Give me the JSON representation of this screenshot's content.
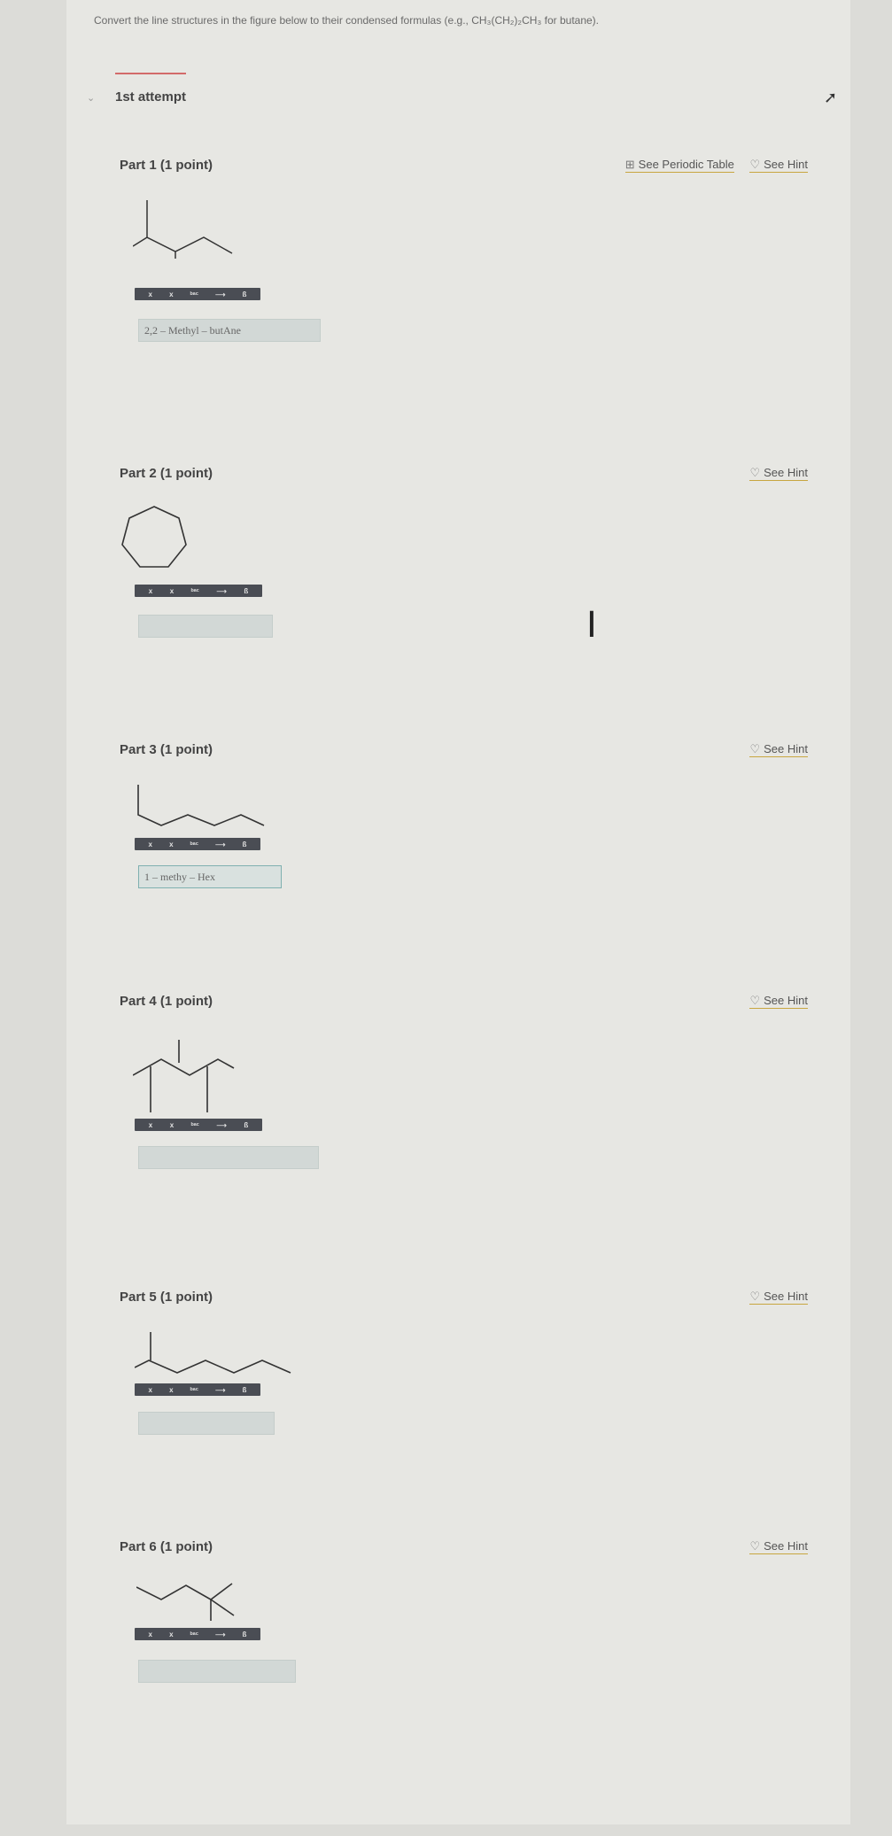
{
  "instructions": "Convert the line structures in the figure below to their condensed formulas (e.g., CH₃(CH₂)₂CH₃ for butane).",
  "attempt": {
    "label": "1st attempt"
  },
  "periodic_table_link": "See Periodic Table",
  "hint_link": "See Hint",
  "toolbar_buttons": [
    "x",
    "x",
    "ᵇᵃᶜ",
    "⟶",
    "ß"
  ],
  "parts": [
    {
      "title": "Part 1  (1 point)",
      "answer": "2,2 – Methyl – butAne"
    },
    {
      "title": "Part 2  (1 point)",
      "answer": ""
    },
    {
      "title": "Part 3  (1 point)",
      "answer": "1 – methy – Hex"
    },
    {
      "title": "Part 4  (1 point)",
      "answer": ""
    },
    {
      "title": "Part 5  (1 point)",
      "answer": ""
    },
    {
      "title": "Part 6  (1 point)",
      "answer": ""
    }
  ],
  "icons": {
    "collapse": "up-arrow-icon",
    "periodic": "periodic-table-icon",
    "hint": "lightbulb-icon",
    "cursor": "text-cursor-icon"
  }
}
